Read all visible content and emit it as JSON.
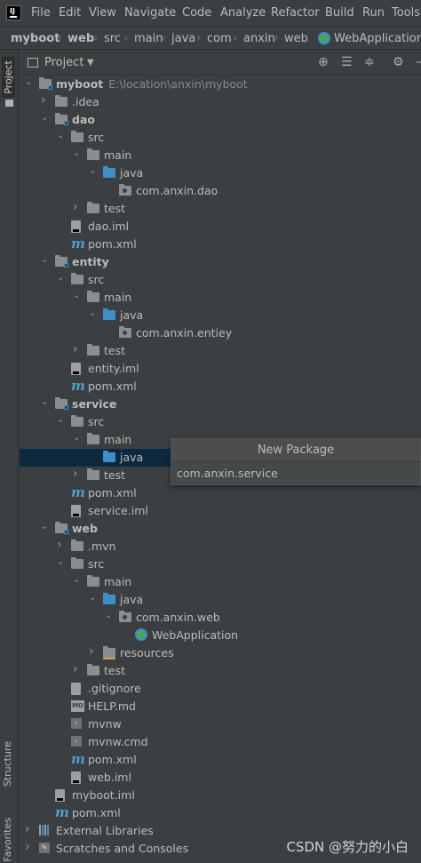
{
  "menubar": {
    "items": [
      {
        "label": "File",
        "mnemonic": "F",
        "rest": "ile"
      },
      {
        "label": "Edit",
        "mnemonic": "E",
        "rest": "dit"
      },
      {
        "label": "View",
        "mnemonic": "V",
        "rest": "iew"
      },
      {
        "label": "Navigate",
        "mnemonic": "N",
        "rest": "avigate"
      },
      {
        "label": "Code",
        "mnemonic": "C",
        "rest": "ode"
      },
      {
        "label": "Analyze",
        "mnemonic": "",
        "rest": "Analyze"
      },
      {
        "label": "Refactor",
        "mnemonic": "R",
        "rest": "efactor"
      },
      {
        "label": "Build",
        "mnemonic": "B",
        "rest": "uild"
      },
      {
        "label": "Run",
        "mnemonic": "R",
        "rest": "un"
      },
      {
        "label": "Tools",
        "mnemonic": "T",
        "rest": "ools"
      }
    ]
  },
  "breadcrumb": {
    "items": [
      "myboot",
      "web",
      "src",
      "main",
      "java",
      "com",
      "anxin",
      "web",
      "WebApplication"
    ]
  },
  "tool_windows": {
    "project_tab": "Project",
    "structure_tab": "Structure",
    "favorites_tab": "Favorites"
  },
  "project_panel": {
    "title": "Project",
    "view_dropdown_icon": "chevron-down-icon"
  },
  "tree": [
    {
      "label": "myboot",
      "hint": "E:\\location\\anxin\\myboot",
      "bold": true,
      "icon": "module-folder",
      "expanded": true
    },
    {
      "label": ".idea",
      "icon": "folder",
      "expanded": false
    },
    {
      "label": "dao",
      "bold": true,
      "icon": "module-folder",
      "expanded": true
    },
    {
      "label": "src",
      "icon": "folder",
      "expanded": true
    },
    {
      "label": "main",
      "icon": "folder",
      "expanded": true
    },
    {
      "label": "java",
      "icon": "source-folder",
      "expanded": true
    },
    {
      "label": "com.anxin.dao",
      "icon": "package"
    },
    {
      "label": "test",
      "icon": "folder",
      "expanded": false
    },
    {
      "label": "dao.iml",
      "icon": "iml-file"
    },
    {
      "label": "pom.xml",
      "icon": "maven-file"
    },
    {
      "label": "entity",
      "bold": true,
      "icon": "module-folder",
      "expanded": true
    },
    {
      "label": "src",
      "icon": "folder",
      "expanded": true
    },
    {
      "label": "main",
      "icon": "folder",
      "expanded": true
    },
    {
      "label": "java",
      "icon": "source-folder",
      "expanded": true
    },
    {
      "label": "com.anxin.entiey",
      "icon": "package"
    },
    {
      "label": "test",
      "icon": "folder",
      "expanded": false
    },
    {
      "label": "entity.iml",
      "icon": "iml-file"
    },
    {
      "label": "pom.xml",
      "icon": "maven-file"
    },
    {
      "label": "service",
      "bold": true,
      "icon": "module-folder",
      "expanded": true
    },
    {
      "label": "src",
      "icon": "folder",
      "expanded": true
    },
    {
      "label": "main",
      "icon": "folder",
      "expanded": true
    },
    {
      "label": "java",
      "icon": "source-folder",
      "selected": true
    },
    {
      "label": "test",
      "icon": "folder",
      "expanded": false
    },
    {
      "label": "pom.xml",
      "icon": "maven-file"
    },
    {
      "label": "service.iml",
      "icon": "iml-file"
    },
    {
      "label": "web",
      "bold": true,
      "icon": "module-folder",
      "expanded": true
    },
    {
      "label": ".mvn",
      "icon": "folder",
      "expanded": false
    },
    {
      "label": "src",
      "icon": "folder",
      "expanded": true
    },
    {
      "label": "main",
      "icon": "folder",
      "expanded": true
    },
    {
      "label": "java",
      "icon": "source-folder",
      "expanded": true
    },
    {
      "label": "com.anxin.web",
      "icon": "package",
      "expanded": true
    },
    {
      "label": "WebApplication",
      "icon": "spring-app"
    },
    {
      "label": "resources",
      "icon": "resources-folder",
      "expanded": false
    },
    {
      "label": "test",
      "icon": "folder",
      "expanded": false
    },
    {
      "label": ".gitignore",
      "icon": "gitignore-file"
    },
    {
      "label": "HELP.md",
      "icon": "markdown-file"
    },
    {
      "label": "mvnw",
      "icon": "terminal-file"
    },
    {
      "label": "mvnw.cmd",
      "icon": "terminal-file"
    },
    {
      "label": "pom.xml",
      "icon": "maven-file"
    },
    {
      "label": "web.iml",
      "icon": "iml-file"
    },
    {
      "label": "myboot.iml",
      "icon": "iml-file"
    },
    {
      "label": "pom.xml",
      "icon": "maven-file"
    },
    {
      "label": "External Libraries",
      "icon": "libraries",
      "expanded": false
    },
    {
      "label": "Scratches and Consoles",
      "icon": "scratches",
      "expanded": false
    }
  ],
  "new_package_dialog": {
    "title": "New Package",
    "value": "com.anxin.service"
  },
  "watermark": "CSDN @努力的小白",
  "colors": {
    "background": "#3c3f41",
    "selection": "#0d293e",
    "source_folder": "#3d8fc6",
    "text": "#bbbbbb"
  }
}
